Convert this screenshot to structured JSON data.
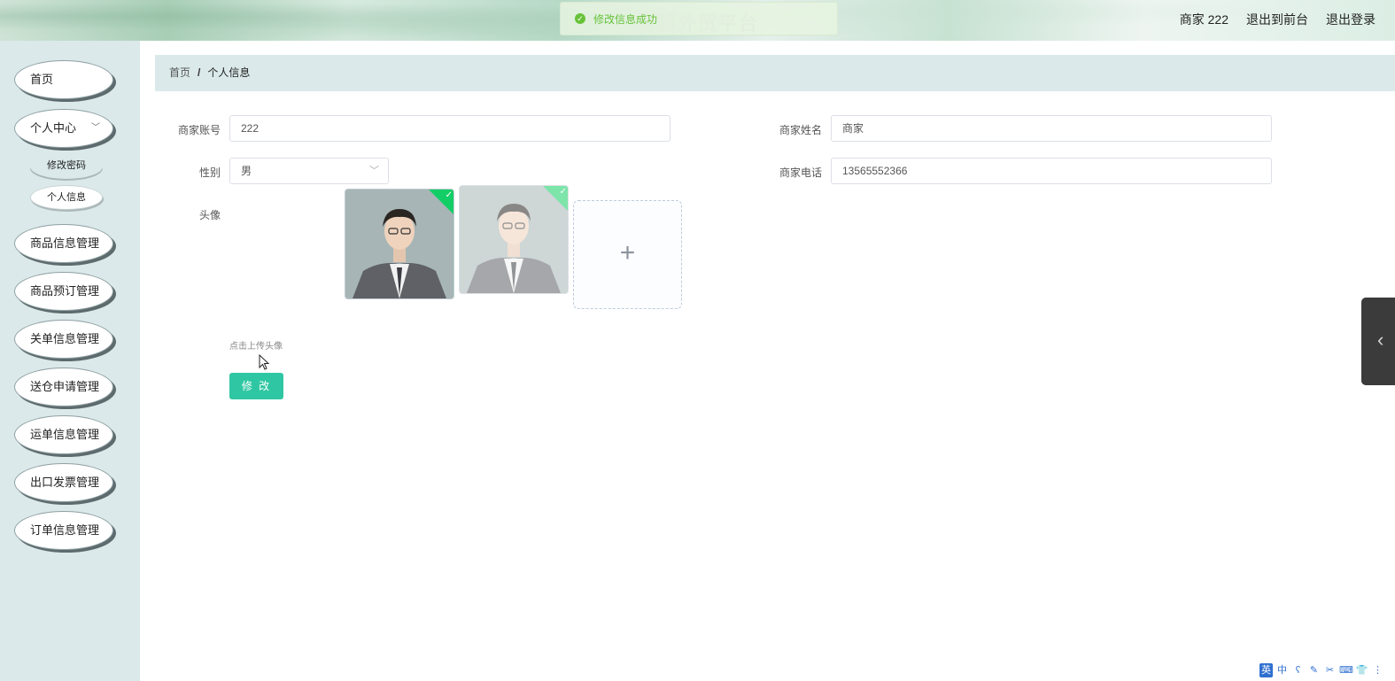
{
  "header": {
    "site_title": "智慧外贸平台",
    "user_label": "商家 222",
    "back_to_front": "退出到前台",
    "logout": "退出登录"
  },
  "toast": {
    "text": "修改信息成功",
    "status": "success",
    "color": "#67c23a"
  },
  "sidebar": {
    "items": [
      {
        "label": "首页"
      },
      {
        "label": "个人中心",
        "expanded": true
      },
      {
        "label": "商品信息管理"
      },
      {
        "label": "商品预订管理"
      },
      {
        "label": "关单信息管理"
      },
      {
        "label": "送仓申请管理"
      },
      {
        "label": "运单信息管理"
      },
      {
        "label": "出口发票管理"
      },
      {
        "label": "订单信息管理"
      }
    ],
    "submenu": [
      {
        "label": "修改密码"
      },
      {
        "label": "个人信息",
        "active": true
      }
    ]
  },
  "breadcrumb": {
    "home": "首页",
    "separator": "/",
    "current": "个人信息"
  },
  "form": {
    "account_label": "商家账号",
    "account_value": "222",
    "name_label": "商家姓名",
    "name_value": "商家",
    "gender_label": "性别",
    "gender_value": "男",
    "phone_label": "商家电话",
    "phone_value": "13565552366",
    "avatar_label": "头像",
    "upload_hint": "点击上传头像",
    "upload_icon": "+",
    "submit_label": "修 改"
  },
  "side_tab": {
    "icon": "chevron-left-icon"
  },
  "ime_bar": {
    "keys": [
      "英",
      "中",
      "ʕ",
      "✎",
      "✂",
      "⌨",
      "👕",
      "⋮"
    ]
  },
  "colors": {
    "accent": "#2fc7a3",
    "sidebar_bg": "#dbe9ea",
    "success": "#13ce66"
  }
}
